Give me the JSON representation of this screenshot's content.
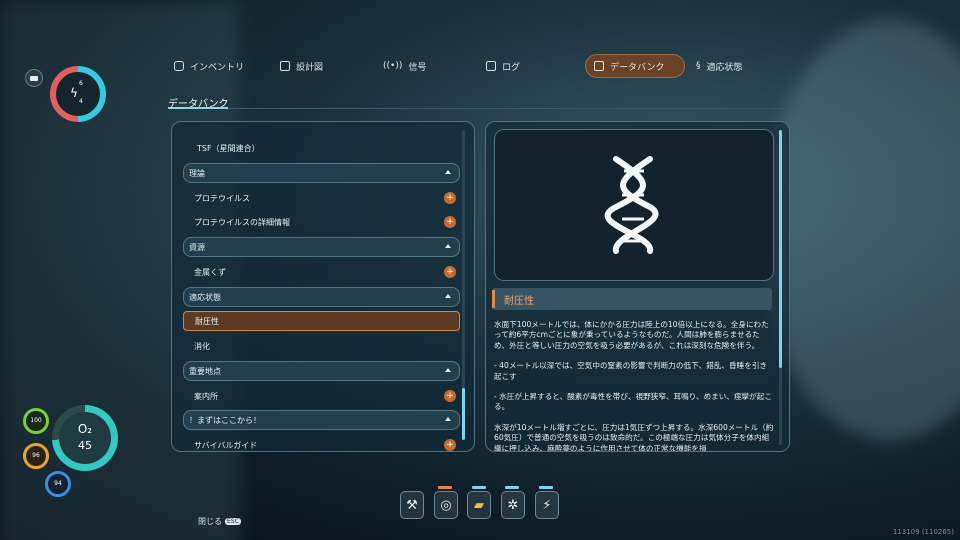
{
  "tabs": [
    {
      "label": "インベントリ",
      "icon": "backpack-icon",
      "active": false
    },
    {
      "label": "設計図",
      "icon": "blueprint-icon",
      "active": false
    },
    {
      "label": "信号",
      "icon": "signal-icon",
      "active": false
    },
    {
      "label": "ログ",
      "icon": "log-icon",
      "active": false
    },
    {
      "label": "データバンク",
      "icon": "databank-icon",
      "active": true
    },
    {
      "label": "適応状態",
      "icon": "dna-icon",
      "active": false
    }
  ],
  "page_title": "データバンク",
  "list": {
    "top_item": "TSF（星間連合）",
    "theory_header": "理論",
    "theory_items": [
      "プロテウイルス",
      "プロテウイルスの詳細情報"
    ],
    "resources_header": "資源",
    "resources_items": [
      "金属くず"
    ],
    "adaptation_header": "適応状態",
    "adaptation_items": [
      "耐圧性",
      "消化"
    ],
    "landmarks_header": "重要地点",
    "landmarks_items": [
      "案内所"
    ],
    "start_header": "！まずはここから！",
    "cut_item": "サバイバルガイド"
  },
  "entry": {
    "title": "耐圧性",
    "paragraphs": [
      "水面下100メートルでは、体にかかる圧力は陸上の10倍以上になる。全身にわたって約6平方cmごとに象が乗っているようなものだ。人間は肺を膨らませるため、外圧と等しい圧力の空気を吸う必要があるが、これは深刻な危険を伴う。",
      "- 40メートル以深では、空気中の窒素の影響で判断力の低下、錯乱、昏睡を引き起こす",
      "- 水圧が上昇すると、酸素が毒性を帯び、視野狭窄、耳鳴り、めまい、痙攣が起こる。",
      "水深が10メートル増すごとに、圧力は1気圧ずつ上昇する。水深600メートル（約60気圧）で普通の空気を吸うのは致命的だ。この極端な圧力は気体分子を体内組織に押し込み、麻酔薬のように作用させて体の正常な機能を損"
    ]
  },
  "hud": {
    "battery_top": "6",
    "battery_bottom": "4",
    "oxygen_label": "O₂",
    "oxygen_value": "45",
    "health": "100",
    "food": "96",
    "water": "94"
  },
  "quickbar": [
    "repair-tool-icon",
    "scanner-icon",
    "flashlight-icon",
    "builder-icon",
    "plug-icon"
  ],
  "close": {
    "label": "閉じる",
    "key": "ESC"
  },
  "build_version": "113109 (110265)",
  "colors": {
    "accent": "#7ed4ea",
    "active_tab": "#6a4326",
    "selected_item": "#5f3a22",
    "plus": "#c46b2d",
    "section_title": "#f2a26a"
  }
}
